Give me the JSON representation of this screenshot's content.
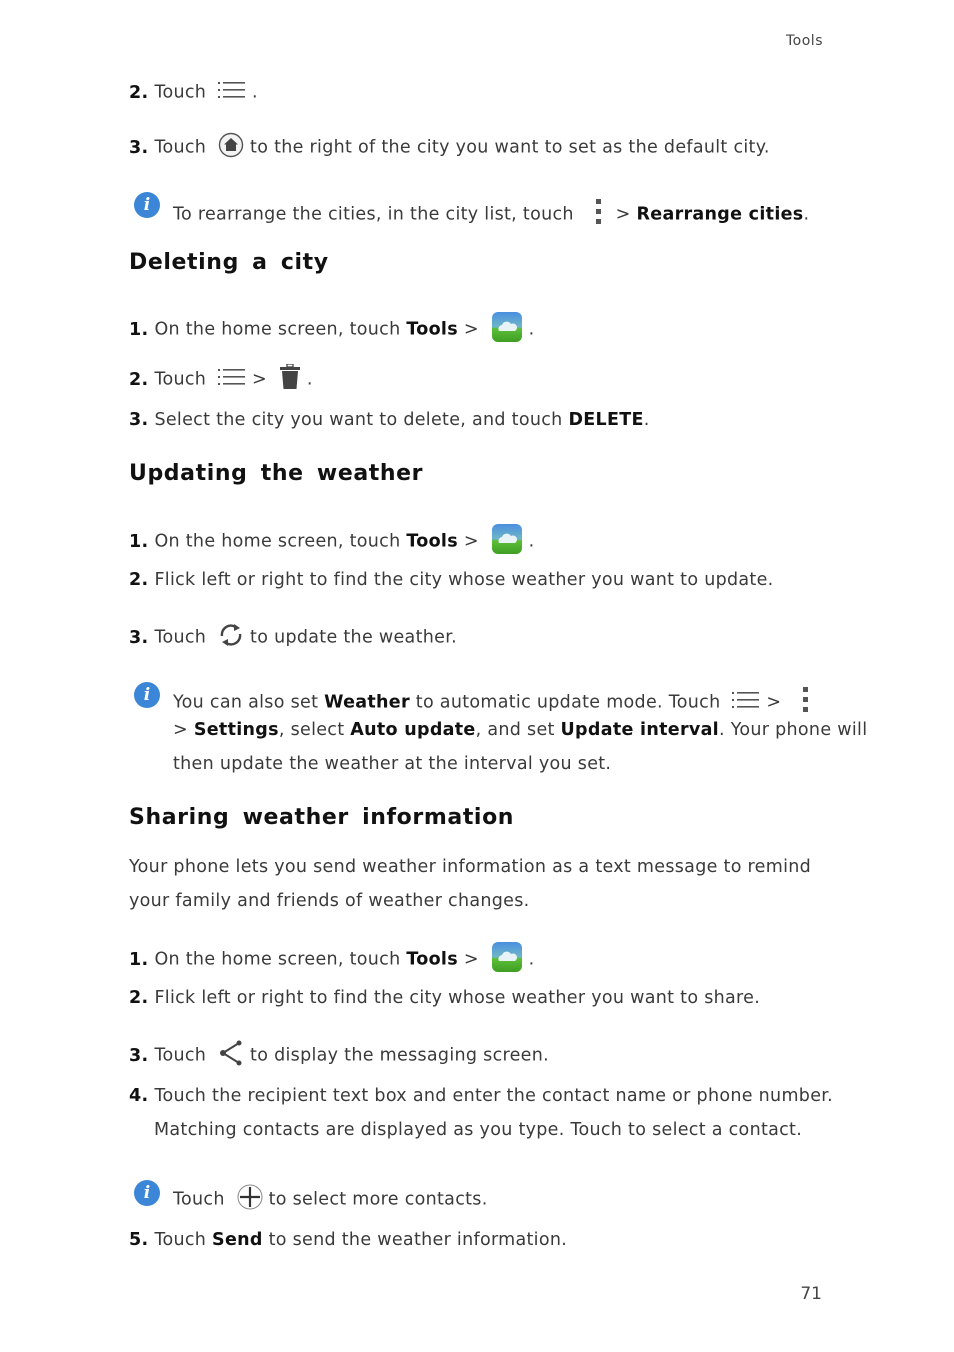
{
  "header": {
    "section": "Tools"
  },
  "page_number": "71",
  "top": {
    "step2": {
      "num": "2.",
      "text": "Touch",
      "end": "."
    },
    "step3": {
      "num": "3.",
      "text": "Touch",
      "rest": "to the right of the city you want to set as the default city."
    },
    "note": {
      "text": "To rearrange the cities, in the city list, touch",
      "sep": ">",
      "bold": "Rearrange cities",
      "end": "."
    }
  },
  "deleting": {
    "title": "Deleting a city",
    "step1": {
      "num": "1.",
      "text": "On the home screen, touch",
      "bold": "Tools",
      "sep": ">",
      "end": "."
    },
    "step2": {
      "num": "2.",
      "text": "Touch",
      "sep": ">",
      "end": "."
    },
    "step3": {
      "num": "3.",
      "text": "Select the city you want to delete, and touch",
      "bold": "DELETE",
      "end": "."
    }
  },
  "updating": {
    "title": "Updating the weather",
    "step1": {
      "num": "1.",
      "text": "On the home screen, touch",
      "bold": "Tools",
      "sep": ">",
      "end": "."
    },
    "step2": {
      "num": "2.",
      "text": "Flick left or right to find the city whose weather you want to update."
    },
    "step3": {
      "num": "3.",
      "text": "Touch",
      "rest": "to update the weather."
    },
    "note": {
      "l1a": "You can also set",
      "l1b": "Weather",
      "l1c": "to automatic update mode. Touch",
      "sep": ">",
      "l2sep": ">",
      "l2a": "Settings",
      "l2b": ", select",
      "l2c": "Auto update",
      "l2d": ", and set",
      "l2e": "Update interval",
      "l2f": ". Your phone will",
      "l3": "then update the weather at the interval you set."
    }
  },
  "sharing": {
    "title": "Sharing weather information",
    "intro1": "Your phone lets you send weather information as a text message to remind",
    "intro2": "your family and friends of weather changes.",
    "step1": {
      "num": "1.",
      "text": "On the home screen, touch",
      "bold": "Tools",
      "sep": ">",
      "end": "."
    },
    "step2": {
      "num": "2.",
      "text": "Flick left or right to find the city whose weather you want to share."
    },
    "step3": {
      "num": "3.",
      "text": "Touch",
      "rest": "to display the messaging screen."
    },
    "step4": {
      "num": "4.",
      "l1": "Touch the recipient text box and enter the contact name or phone number.",
      "l2": "Matching contacts are displayed as you type. Touch to select a contact."
    },
    "note": {
      "text": "Touch",
      "rest": "to select more contacts."
    },
    "step5": {
      "num": "5.",
      "text": "Touch",
      "bold": "Send",
      "rest": "to send the weather information."
    }
  }
}
